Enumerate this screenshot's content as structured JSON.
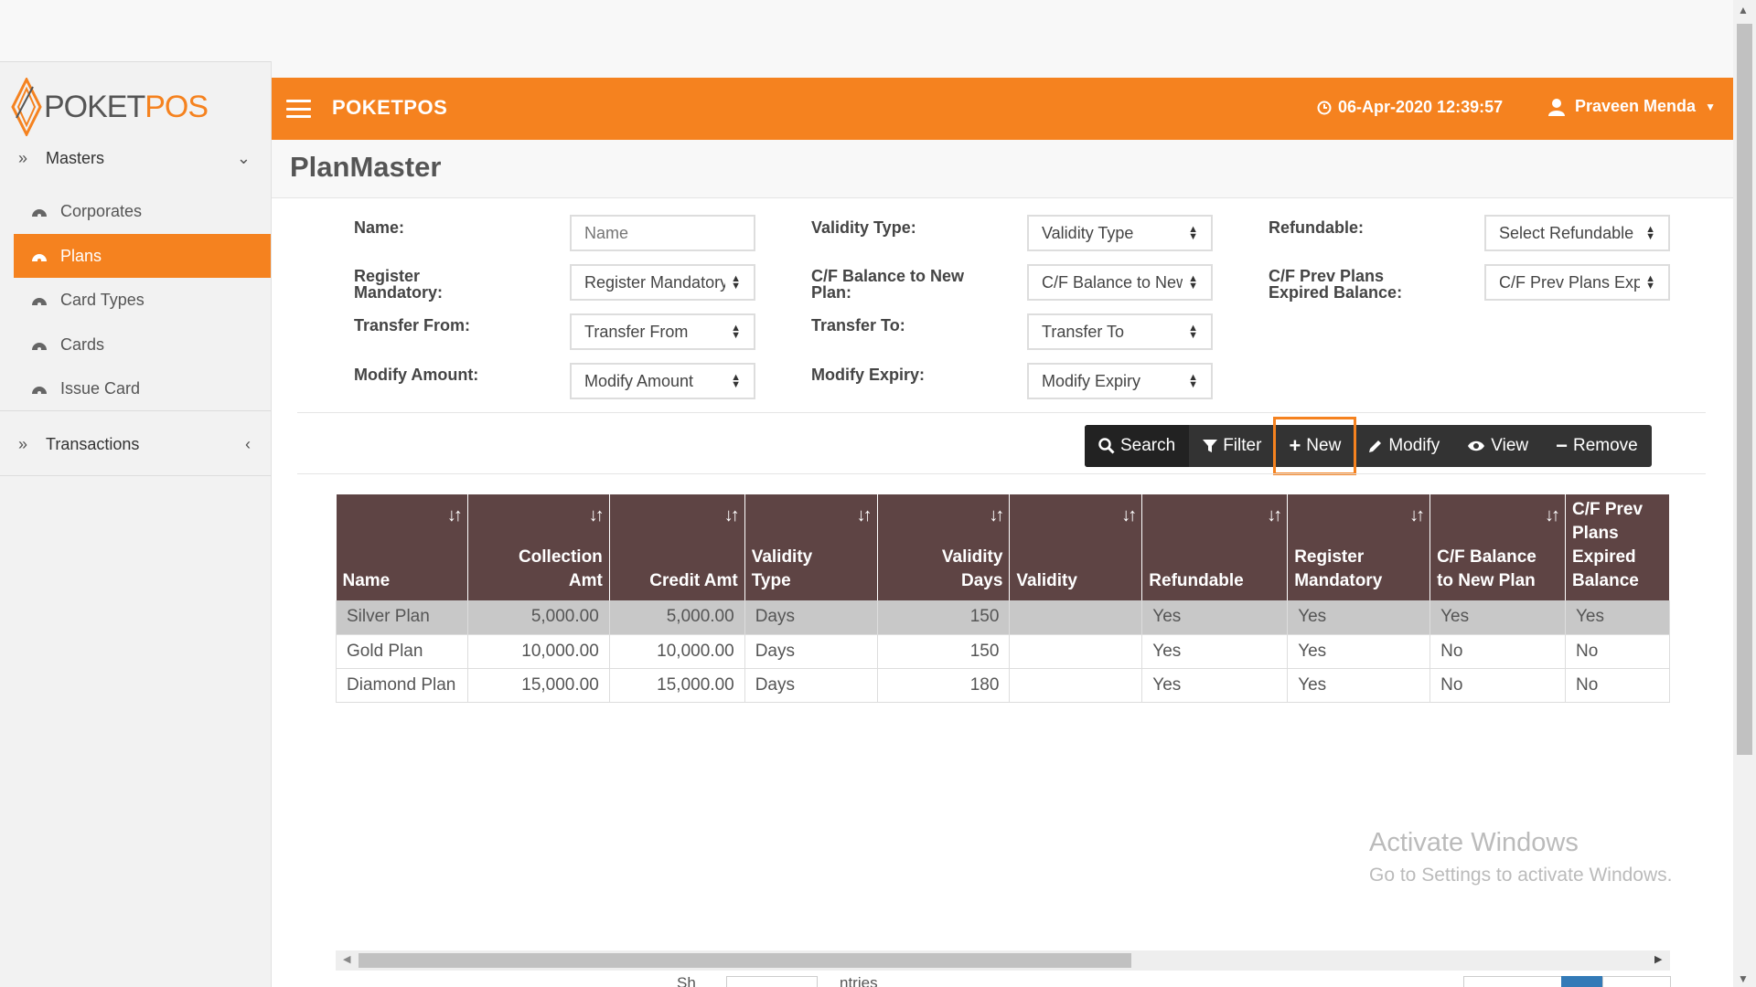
{
  "app": {
    "logo_text_a": "POKET",
    "logo_text_b": "POS",
    "brand": "POKETPOS",
    "datetime": "06-Apr-2020 12:39:57",
    "user": "Praveen Menda"
  },
  "sidebar": {
    "masters": "Masters",
    "transactions": "Transactions",
    "items": [
      {
        "label": "Corporates"
      },
      {
        "label": "Plans"
      },
      {
        "label": "Card Types"
      },
      {
        "label": "Cards"
      },
      {
        "label": "Issue Card"
      }
    ]
  },
  "page": {
    "title": "PlanMaster"
  },
  "form": {
    "name_label": "Name:",
    "name_placeholder": "Name",
    "validity_type_label": "Validity Type:",
    "validity_type_value": "Validity Type",
    "refundable_label": "Refundable:",
    "refundable_value": "Select Refundable",
    "register_mandatory_label_1": "Register",
    "register_mandatory_label_2": "Mandatory:",
    "register_mandatory_value": "Register Mandatory",
    "cf_balance_label_1": "C/F Balance to New",
    "cf_balance_label_2": "Plan:",
    "cf_balance_value": "C/F Balance to New Plan",
    "cf_prev_label_1": "C/F Prev Plans",
    "cf_prev_label_2": "Expired Balance:",
    "cf_prev_value": "C/F Prev Plans Expired Balance",
    "transfer_from_label": "Transfer From:",
    "transfer_from_value": "Transfer From",
    "transfer_to_label": "Transfer To:",
    "transfer_to_value": "Transfer To",
    "modify_amount_label": "Modify Amount:",
    "modify_amount_value": "Modify Amount",
    "modify_expiry_label": "Modify Expiry:",
    "modify_expiry_value": "Modify Expiry"
  },
  "toolbar": {
    "search": "Search",
    "filter": "Filter",
    "new": "New",
    "modify": "Modify",
    "view": "View",
    "remove": "Remove"
  },
  "table": {
    "headers": [
      [
        "Name"
      ],
      [
        "Collection",
        "Amt"
      ],
      [
        "Credit Amt"
      ],
      [
        "Validity",
        "Type"
      ],
      [
        "Validity",
        "Days"
      ],
      [
        "Validity"
      ],
      [
        "Refundable"
      ],
      [
        "Register",
        "Mandatory"
      ],
      [
        "C/F Balance",
        "to New Plan"
      ],
      [
        "C/F Prev",
        "Plans",
        "Expired",
        "Balance"
      ]
    ],
    "rows": [
      [
        "Silver Plan",
        "5,000.00",
        "5,000.00",
        "Days",
        "150",
        "",
        "Yes",
        "Yes",
        "Yes",
        "Yes"
      ],
      [
        "Gold Plan",
        "10,000.00",
        "10,000.00",
        "Days",
        "150",
        "",
        "Yes",
        "Yes",
        "No",
        "No"
      ],
      [
        "Diamond Plan",
        "15,000.00",
        "15,000.00",
        "Days",
        "180",
        "",
        "Yes",
        "Yes",
        "No",
        "No"
      ]
    ]
  },
  "footer": {
    "show_label": "Sh",
    "entries_label": "ntries"
  },
  "watermark": {
    "line1": "Activate Windows",
    "line2": "Go to Settings to activate Windows."
  },
  "colors": {
    "accent": "#f5821f",
    "table_header": "#5e4444",
    "toolbar": "#333333"
  }
}
